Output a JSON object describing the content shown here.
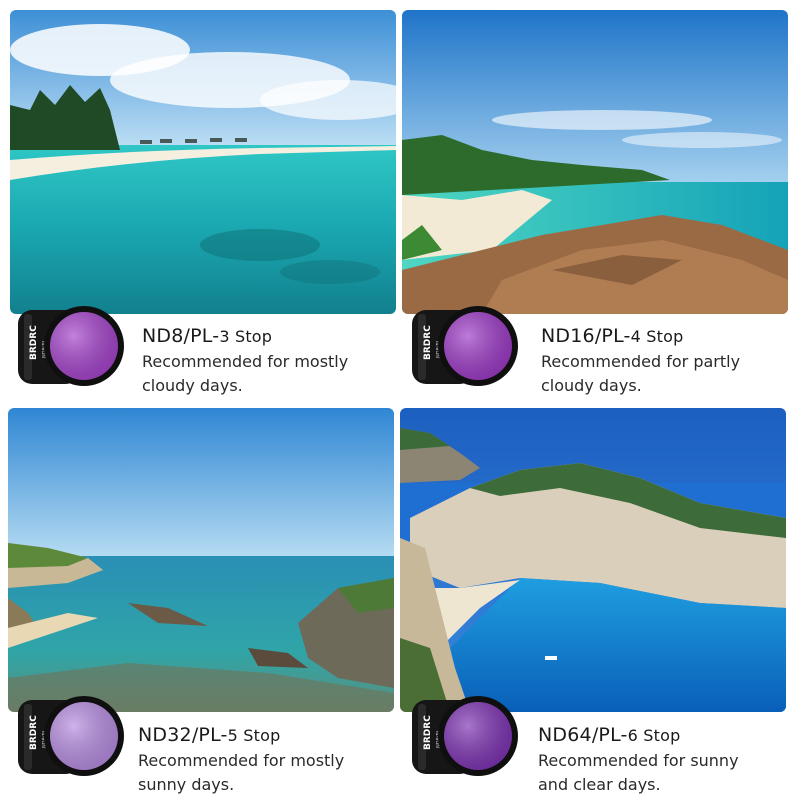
{
  "products": [
    {
      "name": "ND8/PL-",
      "stop": "3 Stop",
      "desc_line1": "Recommended for mostly",
      "desc_line2": "cloudy days.",
      "scene": "tropical-beach",
      "lens_color": "#a23fc9"
    },
    {
      "name": "ND16/PL-",
      "stop": "4 Stop",
      "desc_line1": "Recommended for partly",
      "desc_line2": "cloudy days.",
      "scene": "rocky-coast",
      "lens_color": "#9a36c4"
    },
    {
      "name": "ND32/PL-",
      "stop": "5 Stop",
      "desc_line1": "Recommended for mostly",
      "desc_line2": "sunny days.",
      "scene": "sea-cliffs",
      "lens_color": "#b58ae0"
    },
    {
      "name": "ND64/PL-",
      "stop": "6 Stop",
      "desc_line1": "Recommended for sunny",
      "desc_line2": "and clear days.",
      "scene": "navagio-bay",
      "lens_color": "#7a2eb0"
    }
  ],
  "brand_mark": "BRDRC",
  "lens_model": "ND8/PL"
}
